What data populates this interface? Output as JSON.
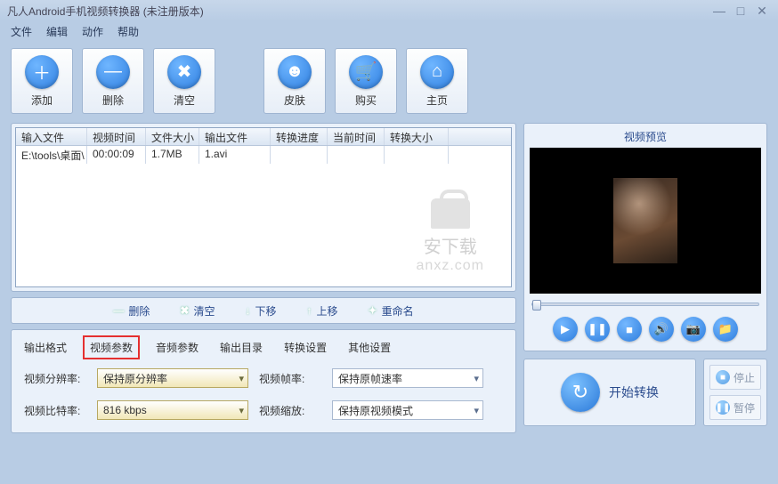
{
  "title": "凡人Android手机视频转换器   (未注册版本)",
  "menu": [
    "文件",
    "编辑",
    "动作",
    "帮助"
  ],
  "toolbar": [
    {
      "icon": "＋",
      "label": "添加",
      "name": "add-button"
    },
    {
      "icon": "—",
      "label": "删除",
      "name": "delete-button"
    },
    {
      "icon": "✖",
      "label": "清空",
      "name": "clear-button"
    },
    {
      "gap": true
    },
    {
      "icon": "☻",
      "label": "皮肤",
      "name": "skin-button"
    },
    {
      "icon": "🛒",
      "label": "购买",
      "name": "buy-button"
    },
    {
      "icon": "⌂",
      "label": "主页",
      "name": "home-button"
    }
  ],
  "grid": {
    "headers": [
      "输入文件",
      "视频时间",
      "文件大小",
      "输出文件",
      "转换进度",
      "当前时间",
      "转换大小"
    ],
    "rows": [
      {
        "c0": "E:\\tools\\桌面\\",
        "c1": "00:00:09",
        "c2": "1.7MB",
        "c3": "1.avi",
        "c4": "",
        "c5": "",
        "c6": ""
      }
    ]
  },
  "watermark": {
    "line1": "安下载",
    "line2": "anxz.com"
  },
  "listops": [
    {
      "sym": "—",
      "label": "删除",
      "name": "list-delete"
    },
    {
      "sym": "✖",
      "label": "清空",
      "name": "list-clear"
    },
    {
      "sym": "↓",
      "label": "下移",
      "name": "list-down"
    },
    {
      "sym": "↑",
      "label": "上移",
      "name": "list-up"
    },
    {
      "sym": "✦",
      "label": "重命名",
      "name": "list-rename"
    }
  ],
  "tabs": [
    "输出格式",
    "视频参数",
    "音频参数",
    "输出目录",
    "转换设置",
    "其他设置"
  ],
  "tab_hl_index": 1,
  "settings": {
    "l0": "视频分辨率:",
    "v0": "保持原分辨率",
    "l1": "视频帧率:",
    "v1": "保持原帧速率",
    "l2": "视频比特率:",
    "v2": "816 kbps",
    "l3": "视频缩放:",
    "v3": "保持原视频模式"
  },
  "preview_label": "视频预览",
  "pbtns": [
    {
      "g": "▶",
      "name": "play-button"
    },
    {
      "g": "❚❚",
      "name": "pause-button"
    },
    {
      "g": "■",
      "name": "stop-button"
    },
    {
      "g": "🔊",
      "name": "volume-button"
    },
    {
      "g": "📷",
      "name": "snapshot-button"
    },
    {
      "g": "📁",
      "name": "open-folder-button"
    }
  ],
  "convert": {
    "label": "开始转换",
    "stop": "停止",
    "pause": "暂停"
  }
}
